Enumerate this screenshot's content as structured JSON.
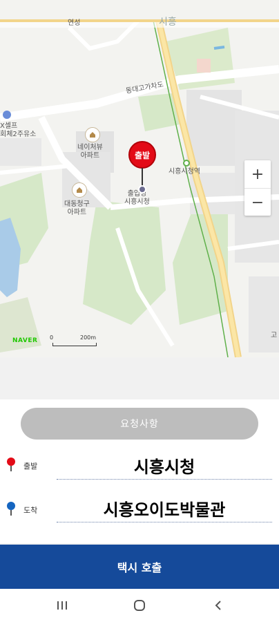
{
  "map": {
    "labels": {
      "apt1": "네이처뷰\n아파트",
      "apt2": "대동청구\n아파트",
      "cityhall": "출입청\n시흥시청",
      "station": "시흥시청역",
      "overpass": "동대고가차도",
      "gas": "X셀프\n회체2주유소",
      "right_edge": "고",
      "top_left": "연성",
      "top_center": "시흥"
    },
    "naver_logo": "NAVER",
    "scale_zero": "0",
    "scale_label": "200m",
    "zoom_in": "+",
    "zoom_out": "−",
    "pin_label": "출발"
  },
  "panel": {
    "request_button": "요청사항",
    "departure": {
      "label": "출발",
      "value": "시흥시청",
      "color": "#e30b17"
    },
    "arrival": {
      "label": "도착",
      "value": "시흥오이도박물관",
      "color": "#1565c0"
    }
  },
  "call_button": "택시 호출",
  "navbar": {
    "recent": "recent-apps",
    "home": "home",
    "back": "back"
  }
}
